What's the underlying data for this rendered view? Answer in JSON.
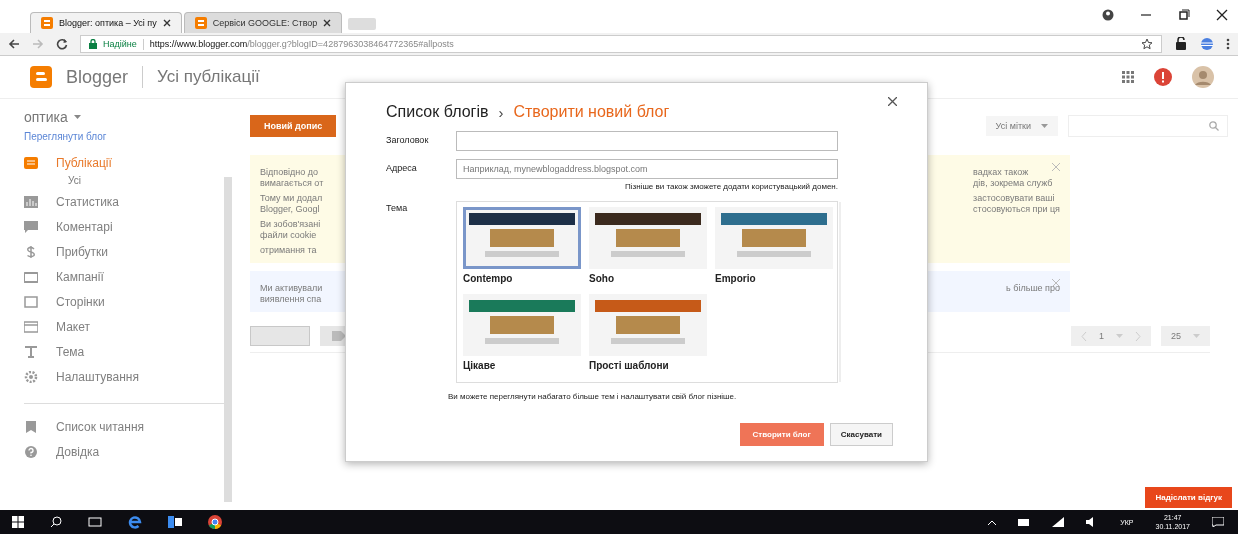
{
  "browser": {
    "tabs": [
      {
        "title": "Blogger: оптика – Усі пу",
        "selected": true
      },
      {
        "title": "Сервіси GOOGLE: Створ",
        "selected": false
      }
    ],
    "security": "Надійне",
    "url_host": "https://www.blogger.com",
    "url_path": "/blogger.g?blogID=4287963038464772365#allposts"
  },
  "app": {
    "brand": "Blogger",
    "page_title": "Усі публікації",
    "blog_name": "оптика",
    "view_blog": "Переглянути блог",
    "new_post": "Новий допис",
    "nav": [
      {
        "label": "Публікації",
        "selected": true,
        "children": [
          {
            "label": "Усі",
            "selected": true
          }
        ]
      },
      {
        "label": "Статистика",
        "selected": false
      },
      {
        "label": "Коментарі",
        "selected": false
      },
      {
        "label": "Прибутки",
        "selected": false
      },
      {
        "label": "Кампанії",
        "selected": false
      },
      {
        "label": "Сторінки",
        "selected": false
      },
      {
        "label": "Макет",
        "selected": false
      },
      {
        "label": "Тема",
        "selected": false
      },
      {
        "label": "Налаштування",
        "selected": false
      }
    ],
    "nav_footer": [
      {
        "label": "Список читання"
      },
      {
        "label": "Довідка"
      }
    ],
    "filter": "Усі мітки",
    "page": "1",
    "per_page": "25",
    "notices": [
      {
        "kind": "warning",
        "left": [
          "Відповідно до",
          "вимагається от",
          "Тому ми додал",
          "Blogger, Googl",
          "Ви зобов'язані",
          "файли cookie",
          "отримання та"
        ],
        "right": [
          "вадках також",
          "дів, зокрема служб",
          "застосовувати ваші",
          "стосовуються при ця"
        ]
      },
      {
        "kind": "info",
        "left": [
          "Ми активували",
          "виявлення спа"
        ],
        "right": [
          "ь більше про"
        ]
      }
    ]
  },
  "dialog": {
    "crumb": "Список блогів",
    "separator": "›",
    "current": "Створити новий блог",
    "title_label": "Заголовок",
    "address_label": "Адреса",
    "address_placeholder": "Наприклад, mynewblogaddress.blogspot.com",
    "address_hint": "Пізніше ви також зможете додати користувацький домен.",
    "theme_label": "Тема",
    "themes": [
      {
        "name": "Contempo",
        "selected": true
      },
      {
        "name": "Soho",
        "selected": false
      },
      {
        "name": "Emporio",
        "selected": false
      },
      {
        "name": "Цікаве",
        "selected": false
      },
      {
        "name": "Прості шаблони",
        "selected": false
      }
    ],
    "theme_note": "Ви можете переглянути набагато більше тем і налаштувати свій блог пізніше.",
    "buttons": [
      {
        "label": "Створити блог",
        "kind": "primary"
      },
      {
        "label": "Скасувати",
        "kind": "secondary"
      }
    ]
  },
  "feedback": "Надіслати відгук",
  "taskbar": {
    "lang": "УКР",
    "time": "21:47",
    "date": "30.11.2017"
  }
}
